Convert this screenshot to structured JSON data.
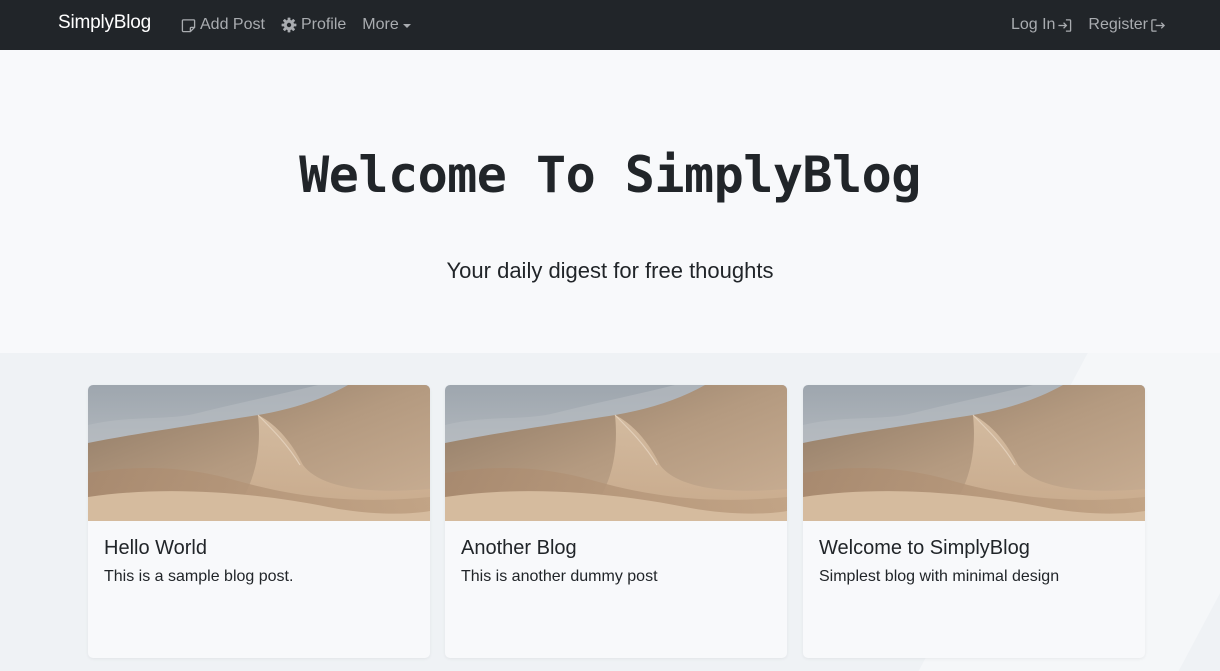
{
  "navbar": {
    "brand": "SimplyBlog",
    "left_links": [
      {
        "label": "Add Post",
        "icon": "sticky-note-icon"
      },
      {
        "label": "Profile",
        "icon": "gear-icon"
      },
      {
        "label": "More",
        "icon": "caret-down-icon"
      }
    ],
    "right_links": [
      {
        "label": "Log In",
        "icon": "login-arrow-icon"
      },
      {
        "label": "Register",
        "icon": "register-arrow-icon"
      }
    ],
    "colors": {
      "background": "#212529",
      "brand": "#ffffff",
      "link": "#a9acb0"
    }
  },
  "hero": {
    "title": "Welcome To SimplyBlog",
    "subtitle": "Your daily digest for free thoughts"
  },
  "posts": [
    {
      "title": "Hello World",
      "text": "This is a sample blog post.",
      "image": "desert-dunes-image"
    },
    {
      "title": "Another Blog",
      "text": "This is another dummy post",
      "image": "desert-dunes-image"
    },
    {
      "title": "Welcome to SimplyBlog",
      "text": "Simplest blog with minimal design",
      "image": "desert-dunes-image"
    }
  ]
}
